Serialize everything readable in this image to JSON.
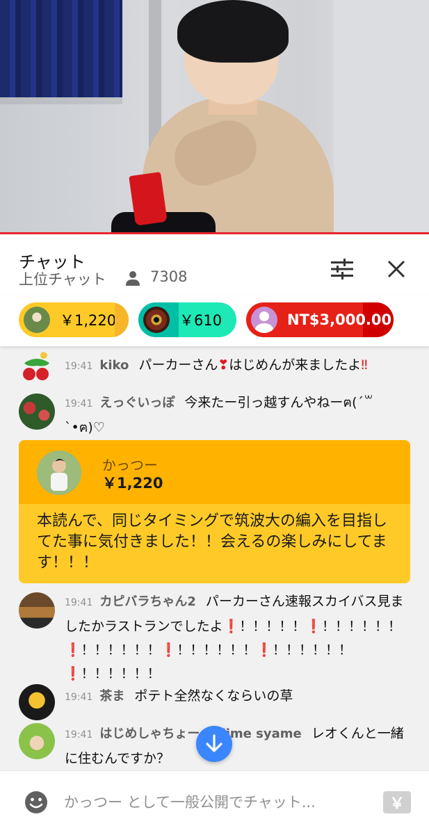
{
  "chat": {
    "title": "チャット",
    "mode": "上位チャット",
    "viewer_count": "7308",
    "icons": {
      "viewers": "person-icon",
      "filter": "sliders-icon",
      "close": "close-icon"
    }
  },
  "ticker": [
    {
      "amount": "￥1,220",
      "color": "#ffca28"
    },
    {
      "amount": "￥610",
      "color": "#1de9b6"
    },
    {
      "amount": "NT$3,000.00",
      "color": "#e62117"
    }
  ],
  "messages": [
    {
      "time": "19:41",
      "author": "kiko",
      "text_a": "パーカーさん",
      "mark_a": "❣",
      "text_b": "はじめんが来ましたよ",
      "mark_b": "‼"
    },
    {
      "time": "19:41",
      "author": "えっぐいっぽ",
      "text": "今来たー引っ越すんやねーฅ(ˊ꒳ˋ•ฅ)♡"
    },
    {
      "time": "19:41",
      "author": "カピバラちゃん2",
      "text": "パーカーさん速報スカイバス見ましたかラストランでしたよ",
      "mark": "❗",
      "tail_1": "！！！！！",
      "tail_2": "！！！！！！",
      "tail_3": "！！！！！！"
    },
    {
      "time": "19:41",
      "author": "茶ま",
      "text": "ポテト全然なくならいの草"
    },
    {
      "time": "19:41",
      "author": "はじめしゃちょー hajime syame",
      "text": "レオくんと一緒に住むんですか？"
    }
  ],
  "superchat": {
    "name": "かっつー",
    "amount": "￥1,220",
    "text": "本読んで、同じタイミングで筑波大の編入を目指してた事に気付きました！！会えるの楽しみにしてます！！！",
    "color_header": "#ffb300",
    "color_body": "#ffca28"
  },
  "input": {
    "placeholder": "かっつー として一般公開でチャット...",
    "currency_button": "￥"
  }
}
